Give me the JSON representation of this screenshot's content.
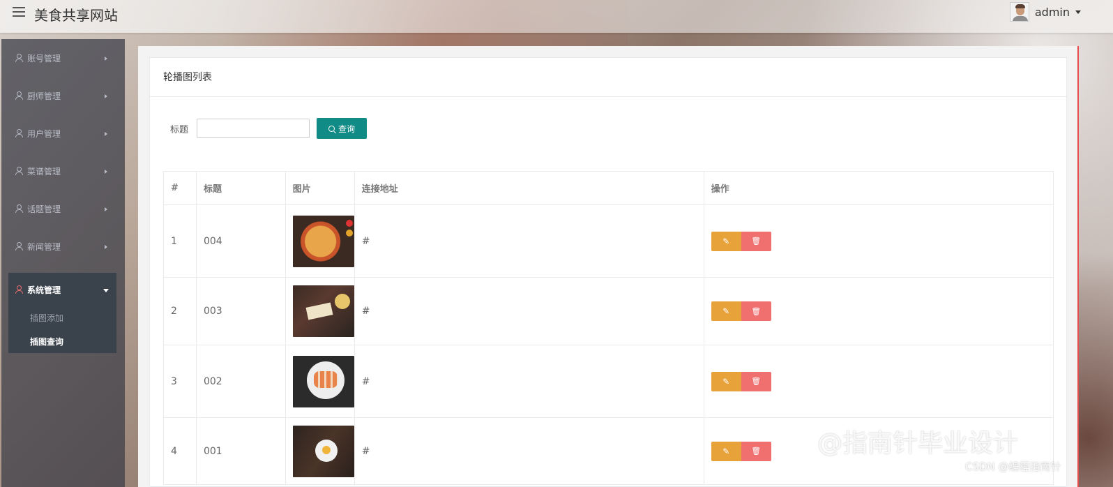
{
  "header": {
    "title": "美食共享网站",
    "username": "admin"
  },
  "sidebar": {
    "items": [
      {
        "label": "账号管理"
      },
      {
        "label": "厨师管理"
      },
      {
        "label": "用户管理"
      },
      {
        "label": "菜谱管理"
      },
      {
        "label": "话题管理"
      },
      {
        "label": "新闻管理"
      }
    ],
    "active": {
      "label": "系统管理",
      "sub": [
        {
          "label": "插图添加",
          "active": false
        },
        {
          "label": "插图查询",
          "active": true
        }
      ]
    }
  },
  "panel": {
    "title": "轮播图列表",
    "search_label": "标题",
    "search_value": "",
    "query_label": "查询"
  },
  "table": {
    "headers": [
      "#",
      "标题",
      "图片",
      "连接地址",
      "操作"
    ],
    "rows": [
      {
        "index": "1",
        "title": "004",
        "image": "pizza",
        "link": "#"
      },
      {
        "index": "2",
        "title": "003",
        "image": "cheese-platter",
        "link": "#"
      },
      {
        "index": "3",
        "title": "002",
        "image": "sushi",
        "link": "#"
      },
      {
        "index": "4",
        "title": "001",
        "image": "breakfast",
        "link": "#"
      }
    ]
  },
  "icons": {
    "edit": "pencil-icon",
    "delete": "trash-icon",
    "search": "search-icon",
    "menu": "hamburger-icon"
  },
  "colors": {
    "query_button": "#108b86",
    "edit_button": "#e8a23a",
    "delete_button": "#f07070",
    "sidebar_active_icon": "#f07070"
  },
  "watermark": {
    "main": "@指南针毕业设计",
    "sub": "CSDN @编程指南针"
  }
}
